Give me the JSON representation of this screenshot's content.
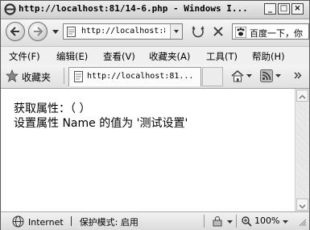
{
  "window": {
    "title": "http://localhost:81/14-6.php - Windows I..."
  },
  "address": {
    "url": "http://localhost:8"
  },
  "search": {
    "placeholder": "百度一下，你"
  },
  "menu": [
    {
      "label": "文件(F)"
    },
    {
      "label": "编辑(E)"
    },
    {
      "label": "查看(V)"
    },
    {
      "label": "收藏夹(A)"
    },
    {
      "label": "工具(T)"
    },
    {
      "label": "帮助(H)"
    }
  ],
  "favorites": {
    "label": "收藏夹"
  },
  "tab": {
    "title": "http://localhost:81..."
  },
  "page": {
    "line1": "获取属性：（ ）",
    "line2": "设置属性 Name 的值为 '测试设置'"
  },
  "status": {
    "zone": "Internet",
    "protected_mode": "保护模式: 启用",
    "zoom": "100%"
  },
  "icons": {
    "ie_logo": "ie-logo-icon",
    "back": "back-arrow-icon",
    "forward": "forward-arrow-icon",
    "refresh": "refresh-icon",
    "stop": "stop-icon",
    "search_engine": "paw-icon",
    "favorites": "star-icon",
    "home": "home-icon",
    "feeds": "rss-icon",
    "globe": "globe-icon"
  }
}
